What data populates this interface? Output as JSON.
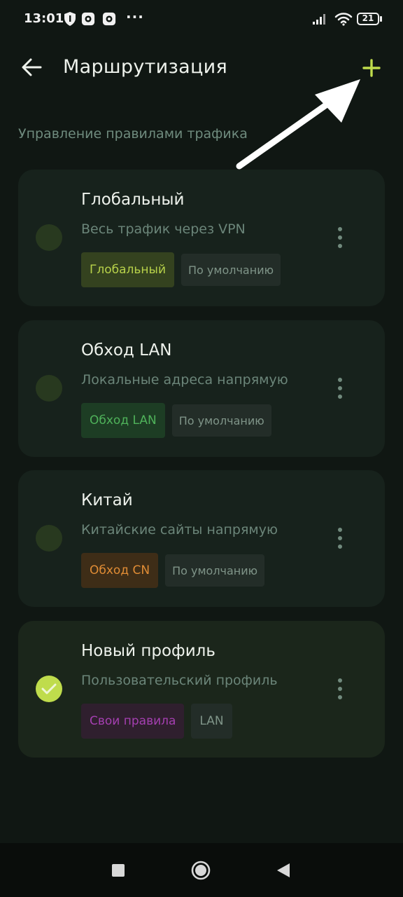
{
  "status_bar": {
    "time": "13:01",
    "dots": "···",
    "battery": "21"
  },
  "header": {
    "title": "Маршрутизация"
  },
  "section_label": "Управление правилами трафика",
  "profiles": [
    {
      "title": "Глобальный",
      "description": "Весь трафик через VPN",
      "selected": false,
      "tags": [
        {
          "label": "Глобальный",
          "style": "green"
        },
        {
          "label": "По умолчанию",
          "style": "grey"
        }
      ]
    },
    {
      "title": "Обход LAN",
      "description": "Локальные адреса напрямую",
      "selected": false,
      "tags": [
        {
          "label": "Обход LAN",
          "style": "lan"
        },
        {
          "label": "По умолчанию",
          "style": "grey"
        }
      ]
    },
    {
      "title": "Китай",
      "description": "Китайские сайты напрямую",
      "selected": false,
      "tags": [
        {
          "label": "Обход CN",
          "style": "cn"
        },
        {
          "label": "По умолчанию",
          "style": "grey"
        }
      ]
    },
    {
      "title": "Новый профиль",
      "description": "Пользовательский профиль",
      "selected": true,
      "tags": [
        {
          "label": "Свои правила",
          "style": "purple"
        },
        {
          "label": "LAN",
          "style": "grey"
        }
      ]
    }
  ],
  "colors": {
    "background": "#101713",
    "accent": "#bfdc4c",
    "card": "#17221c"
  }
}
